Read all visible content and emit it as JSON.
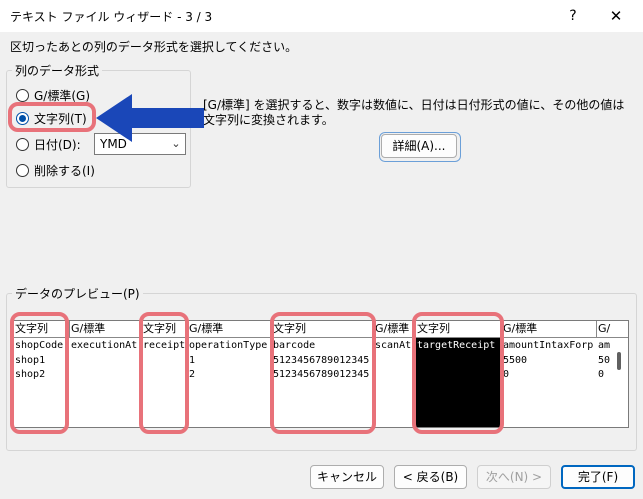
{
  "window": {
    "title": "テキスト ファイル ウィザード - 3 / 3",
    "help_symbol": "?",
    "close_symbol": "✕"
  },
  "instruction": "区切ったあとの列のデータ形式を選択してください。",
  "format_group": {
    "legend": "列のデータ形式",
    "options": [
      {
        "label": "G/標準(G)",
        "checked": false
      },
      {
        "label": "文字列(T)",
        "checked": true
      },
      {
        "label": "日付(D):",
        "checked": false
      },
      {
        "label": "削除する(I)",
        "checked": false
      }
    ],
    "date_value": "YMD",
    "date_arrow_icon": "chevron-down-icon"
  },
  "description": "[G/標準] を選択すると、数字は数値に、日付は日付形式の値に、その他の値は文字列に変換されます。",
  "advanced_button": "詳細(A)...",
  "preview": {
    "legend": "データのプレビュー(P)",
    "columns": [
      {
        "header": "文字列",
        "cells": [
          "shopCode",
          "shop1",
          "shop2"
        ],
        "selected": false
      },
      {
        "header": "G/標準",
        "cells": [
          "executionAt",
          "",
          ""
        ],
        "selected": false
      },
      {
        "header": "文字列",
        "cells": [
          "receipt",
          "",
          ""
        ],
        "selected": false
      },
      {
        "header": "G/標準",
        "cells": [
          "operationType",
          "1",
          "2"
        ],
        "selected": false
      },
      {
        "header": "文字列",
        "cells": [
          "barcode",
          "5123456789012345",
          "5123456789012345"
        ],
        "selected": false
      },
      {
        "header": "G/標準",
        "cells": [
          "scanAt",
          "",
          ""
        ],
        "selected": false
      },
      {
        "header": "文字列",
        "cells": [
          "targetReceipt",
          "",
          ""
        ],
        "selected": true
      },
      {
        "header": "G/標準",
        "cells": [
          "amountIntaxForp",
          "5500",
          "0"
        ],
        "selected": false
      },
      {
        "header": "G/",
        "cells": [
          "am",
          "50",
          "0"
        ],
        "selected": false
      }
    ]
  },
  "buttons": {
    "cancel": "キャンセル",
    "back": "< 戻る(B)",
    "next": "次へ(N) >",
    "finish": "完了(F)"
  },
  "colors": {
    "highlight": "#e8727a",
    "arrow": "#1a47b8",
    "accent": "#0067c0"
  }
}
